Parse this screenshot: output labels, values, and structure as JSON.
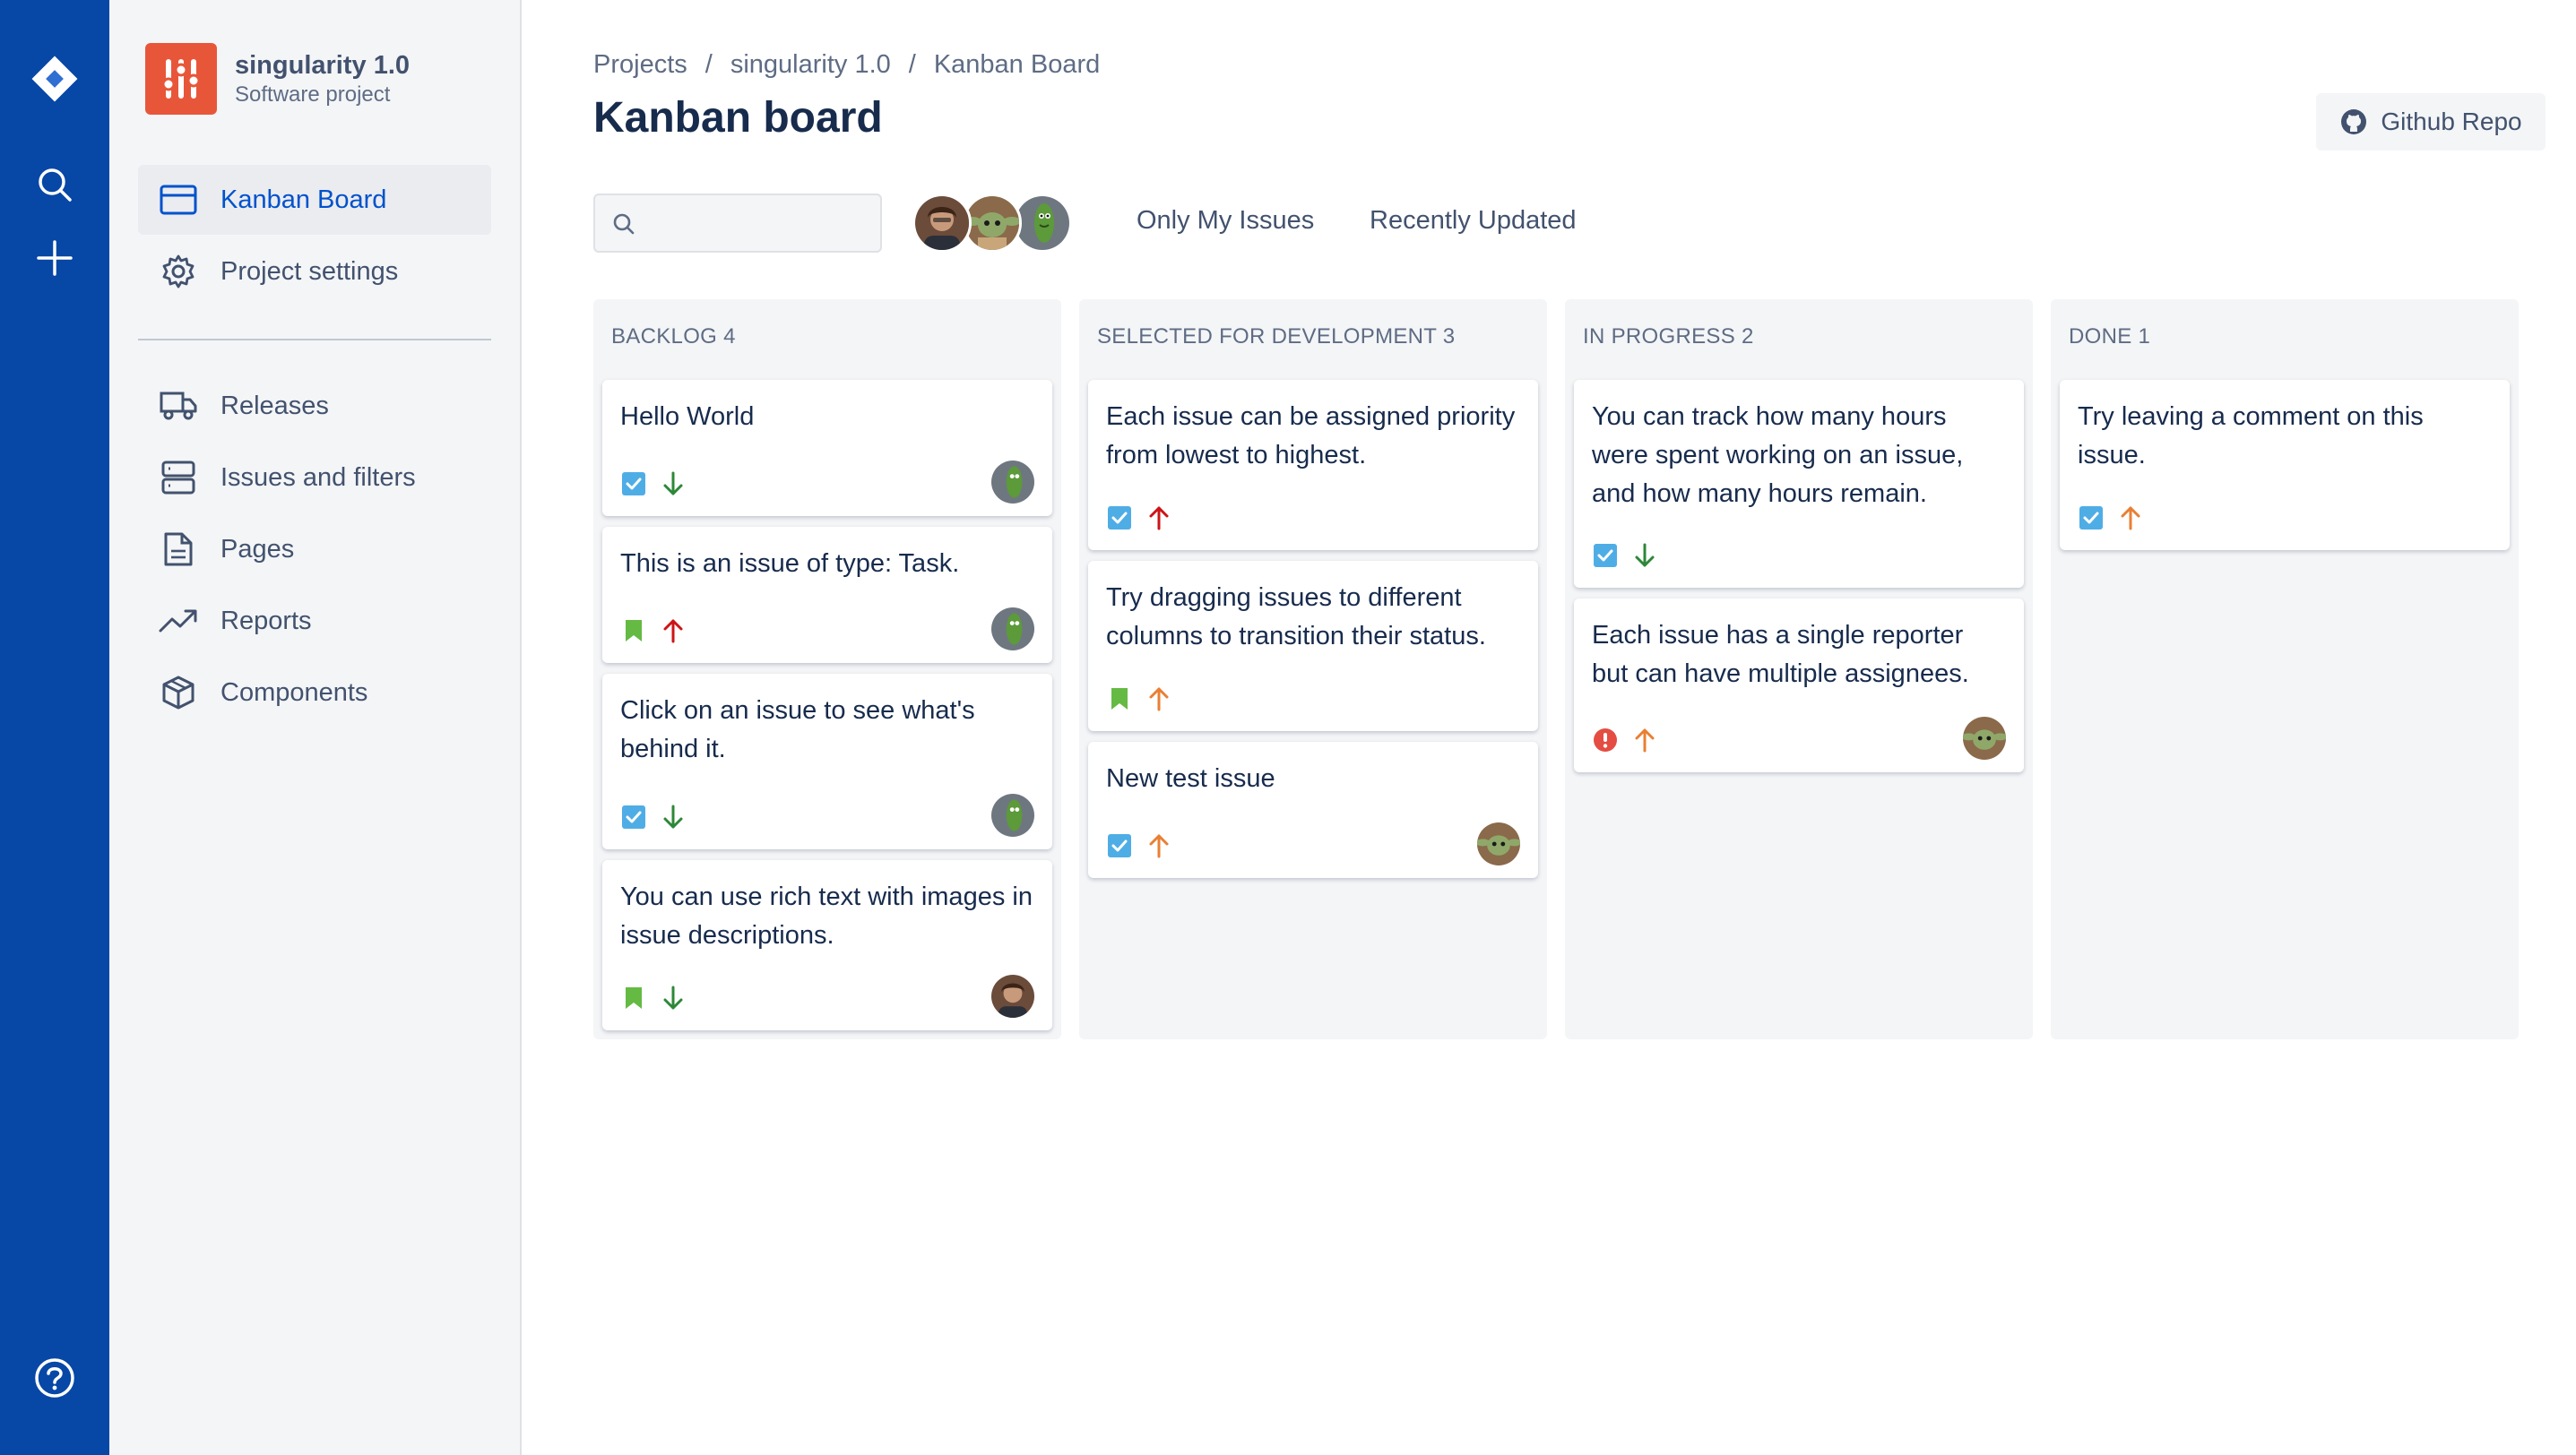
{
  "navbar": {
    "logo_icon": "jira-logo-icon",
    "search_icon": "search-icon",
    "create_icon": "plus-icon",
    "help_icon": "help-icon"
  },
  "project": {
    "name": "singularity 1.0",
    "category": "Software project",
    "avatar_color": "#e8563a"
  },
  "sidebar": {
    "items": [
      {
        "label": "Kanban Board",
        "icon": "board-icon",
        "active": true
      },
      {
        "label": "Project settings",
        "icon": "gear-icon",
        "active": false
      },
      {
        "label": "Releases",
        "icon": "truck-icon",
        "active": false
      },
      {
        "label": "Issues and filters",
        "icon": "database-icon",
        "active": false
      },
      {
        "label": "Pages",
        "icon": "page-icon",
        "active": false
      },
      {
        "label": "Reports",
        "icon": "trending-up-icon",
        "active": false
      },
      {
        "label": "Components",
        "icon": "box-icon",
        "active": false
      }
    ]
  },
  "breadcrumb": {
    "items": [
      "Projects",
      "singularity 1.0",
      "Kanban Board"
    ],
    "separator": "/"
  },
  "header": {
    "title": "Kanban board",
    "github_label": "Github Repo"
  },
  "filters": {
    "search_value": "",
    "only_my_issues": "Only My Issues",
    "recently_updated": "Recently Updated"
  },
  "colors": {
    "navbar": "#0747a6",
    "accent": "#0052cc",
    "task": "#4fade6",
    "story": "#65ba43",
    "bug": "#e44d42",
    "priority_high": "#cd1317",
    "priority_medium": "#e97f33",
    "priority_low": "#2d8738"
  },
  "board": {
    "columns": [
      {
        "title": "Backlog",
        "count": "4",
        "heading": "BACKLOG 4"
      },
      {
        "title": "Selected for development",
        "count": "3",
        "heading": "SELECTED FOR DEVELOPMENT 3"
      },
      {
        "title": "In progress",
        "count": "2",
        "heading": "IN PROGRESS 2"
      },
      {
        "title": "Done",
        "count": "1",
        "heading": "DONE 1"
      }
    ],
    "cards": [
      {
        "title": "Hello World",
        "type": "task",
        "priority": "low",
        "assignee": "pickle"
      },
      {
        "title": "This is an issue of type: Task.",
        "type": "story",
        "priority": "high",
        "assignee": "pickle"
      },
      {
        "title": "Click on an issue to see what's behind it.",
        "type": "task",
        "priority": "low",
        "assignee": "pickle"
      },
      {
        "title": "You can use rich text with images in issue descriptions.",
        "type": "story",
        "priority": "low",
        "assignee": "man"
      },
      {
        "title": "Each issue can be assigned priority from lowest to highest.",
        "type": "task",
        "priority": "high",
        "assignee": ""
      },
      {
        "title": "Try dragging issues to different columns to transition their status.",
        "type": "story",
        "priority": "medium",
        "assignee": ""
      },
      {
        "title": "New test issue",
        "type": "task",
        "priority": "medium",
        "assignee": "yoda"
      },
      {
        "title": "You can track how many hours were spent working on an issue, and how many hours remain.",
        "type": "task",
        "priority": "low",
        "assignee": ""
      },
      {
        "title": "Each issue has a single reporter but can have multiple assignees.",
        "type": "bug",
        "priority": "medium",
        "assignee": "yoda"
      },
      {
        "title": "Try leaving a comment on this issue.",
        "type": "task",
        "priority": "medium",
        "assignee": ""
      }
    ]
  }
}
